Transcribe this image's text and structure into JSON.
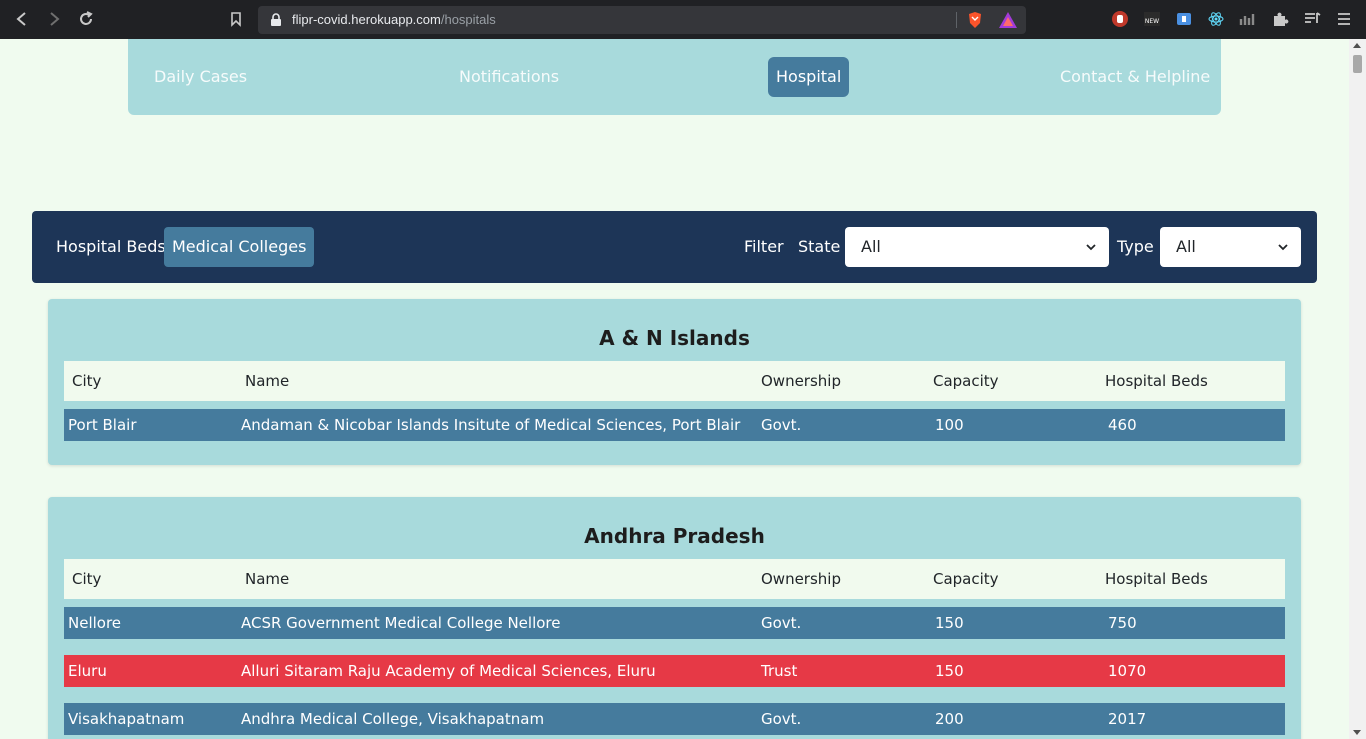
{
  "browser": {
    "url_host": "flipr-covid.herokuapp.com",
    "url_path": "/hospitals"
  },
  "nav": {
    "items": [
      {
        "label": "Daily Cases"
      },
      {
        "label": "Notifications"
      },
      {
        "label": "Hospital"
      },
      {
        "label": "Contact & Helpline"
      }
    ]
  },
  "filter_bar": {
    "toggles": [
      {
        "label": "Hospital Beds"
      },
      {
        "label": "Medical Colleges"
      }
    ],
    "filter_label": "Filter",
    "state_label": "State",
    "state_value": "All",
    "type_label": "Type",
    "type_value": "All"
  },
  "table_headers": {
    "city": "City",
    "name": "Name",
    "ownership": "Ownership",
    "capacity": "Capacity",
    "beds": "Hospital Beds"
  },
  "states": [
    {
      "name": "A & N Islands",
      "rows": [
        {
          "city": "Port Blair",
          "name": "Andaman & Nicobar Islands Insitute of Medical Sciences, Port Blair",
          "ownership": "Govt.",
          "capacity": "100",
          "beds": "460"
        }
      ]
    },
    {
      "name": "Andhra Pradesh",
      "rows": [
        {
          "city": "Nellore",
          "name": "ACSR Government Medical College Nellore",
          "ownership": "Govt.",
          "capacity": "150",
          "beds": "750"
        },
        {
          "city": "Eluru",
          "name": "Alluri Sitaram Raju Academy of Medical Sciences, Eluru",
          "ownership": "Trust",
          "capacity": "150",
          "beds": "1070"
        },
        {
          "city": "Visakhapatnam",
          "name": "Andhra Medical College, Visakhapatnam",
          "ownership": "Govt.",
          "capacity": "200",
          "beds": "2017"
        }
      ]
    }
  ],
  "colors": {
    "nav_bg": "#a8dadc",
    "active": "#457b9d",
    "filter_bg": "#1d3557",
    "govt_row": "#457b9d",
    "trust_row": "#e63946",
    "header_row": "#f1faee"
  }
}
